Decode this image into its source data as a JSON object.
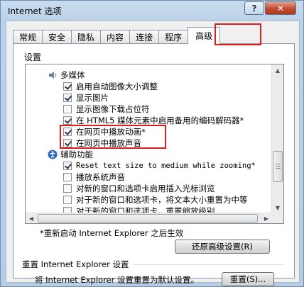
{
  "window": {
    "title": "Internet 选项",
    "help_label": "?",
    "close_label": "✕"
  },
  "tabs": [
    {
      "label": "常规"
    },
    {
      "label": "安全"
    },
    {
      "label": "隐私"
    },
    {
      "label": "内容"
    },
    {
      "label": "连接"
    },
    {
      "label": "程序"
    },
    {
      "label": "高级",
      "active": true
    }
  ],
  "settings": {
    "group_label": "设置",
    "items": [
      {
        "type": "category",
        "label": "多媒体",
        "icon": "multimedia-icon"
      },
      {
        "type": "checkbox",
        "label": "启用自动图像大小调整",
        "checked": true
      },
      {
        "type": "checkbox",
        "label": "显示图片",
        "checked": true
      },
      {
        "type": "checkbox",
        "label": "显示图像下载占位符",
        "checked": false
      },
      {
        "type": "checkbox",
        "label": "在 HTML5 媒体元素中启用备用的编码解码器*",
        "checked": true
      },
      {
        "type": "checkbox",
        "label": "在网页中播放动画*",
        "checked": true
      },
      {
        "type": "checkbox",
        "label": "在网页中播放声音",
        "checked": true
      },
      {
        "type": "category",
        "label": "辅助功能",
        "icon": "accessibility-icon"
      },
      {
        "type": "checkbox",
        "label": "Reset text size to medium while zooming*",
        "checked": true
      },
      {
        "type": "checkbox",
        "label": "播放系统声音",
        "checked": false
      },
      {
        "type": "checkbox",
        "label": "对新的窗口和选项卡启用插入光标浏览",
        "checked": false
      },
      {
        "type": "checkbox",
        "label": "对于新的窗口和选项卡，将文本大小重置为中等",
        "checked": false
      },
      {
        "type": "checkbox",
        "label": "对于新的窗口和选项卡，重置缩放级别",
        "checked": false
      }
    ]
  },
  "note": "*重新启动 Internet Explorer 之后生效",
  "restore_button": "还原高级设置(R)",
  "reset_group": {
    "title": "重置 Internet Explorer 设置",
    "description": "将 Internet Explorer 设置重置为默认设置。",
    "button": "重置(S)..."
  },
  "colors": {
    "highlight": "#e21b1b"
  }
}
